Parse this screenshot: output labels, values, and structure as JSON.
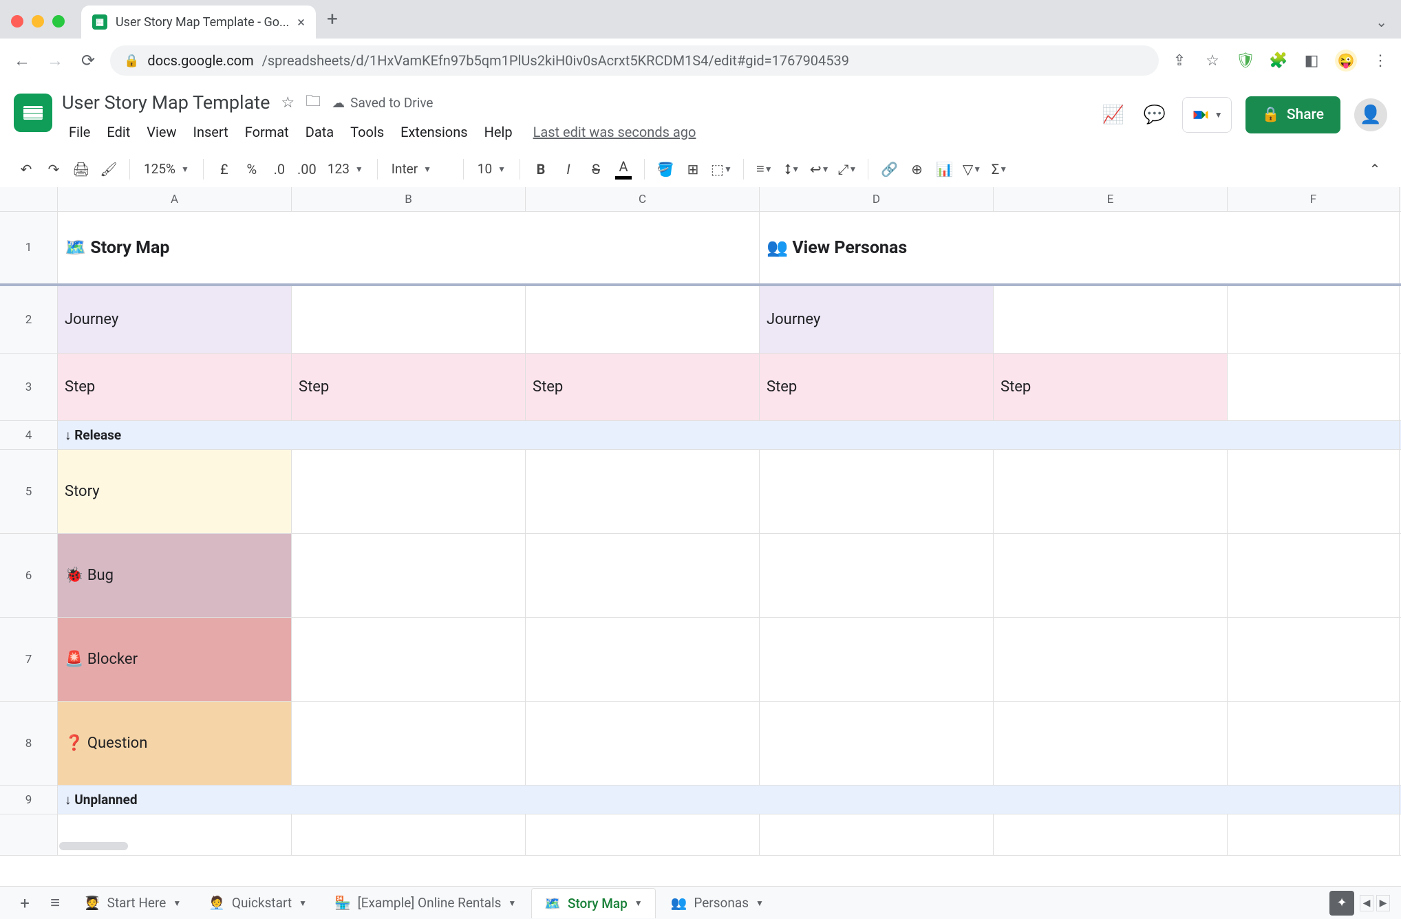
{
  "browser": {
    "tab_title": "User Story Map Template - Go...",
    "url_host": "docs.google.com",
    "url_path": "/spreadsheets/d/1HxVamKEfn97b5qm1PlUs2kiH0iv0sAcrxt5KRCDM1S4/edit#gid=1767904539"
  },
  "doc": {
    "title": "User Story Map Template",
    "save_status": "Saved to Drive",
    "last_edit": "Last edit was seconds ago"
  },
  "menus": [
    "File",
    "Edit",
    "View",
    "Insert",
    "Format",
    "Data",
    "Tools",
    "Extensions",
    "Help"
  ],
  "toolbar": {
    "zoom": "125%",
    "font": "Inter",
    "font_size": "10",
    "more_formats": "123"
  },
  "share_label": "Share",
  "columns": [
    "A",
    "B",
    "C",
    "D",
    "E",
    "F"
  ],
  "rows": {
    "r1": {
      "num": "1",
      "a_merged": "🗺️  Story Map",
      "d_merged": "👥  View Personas"
    },
    "r2": {
      "num": "2",
      "a": "Journey",
      "d": "Journey"
    },
    "r3": {
      "num": "3",
      "a": "Step",
      "b": "Step",
      "c": "Step",
      "d": "Step",
      "e": "Step"
    },
    "r4": {
      "num": "4",
      "a": "↓ Release"
    },
    "r5": {
      "num": "5",
      "a": "Story"
    },
    "r6": {
      "num": "6",
      "a": "🐞  Bug"
    },
    "r7": {
      "num": "7",
      "a": "🚨  Blocker"
    },
    "r8": {
      "num": "8",
      "a": "❓  Question"
    },
    "r9": {
      "num": "9",
      "a": "↓ Unplanned"
    }
  },
  "sheet_tabs": [
    {
      "icon": "🧑‍🎓",
      "label": "Start Here"
    },
    {
      "icon": "🧑‍💼",
      "label": "Quickstart"
    },
    {
      "icon": "🏪",
      "label": "[Example] Online Rentals"
    },
    {
      "icon": "🗺️",
      "label": "Story Map",
      "active": true
    },
    {
      "icon": "👥",
      "label": "Personas"
    }
  ]
}
